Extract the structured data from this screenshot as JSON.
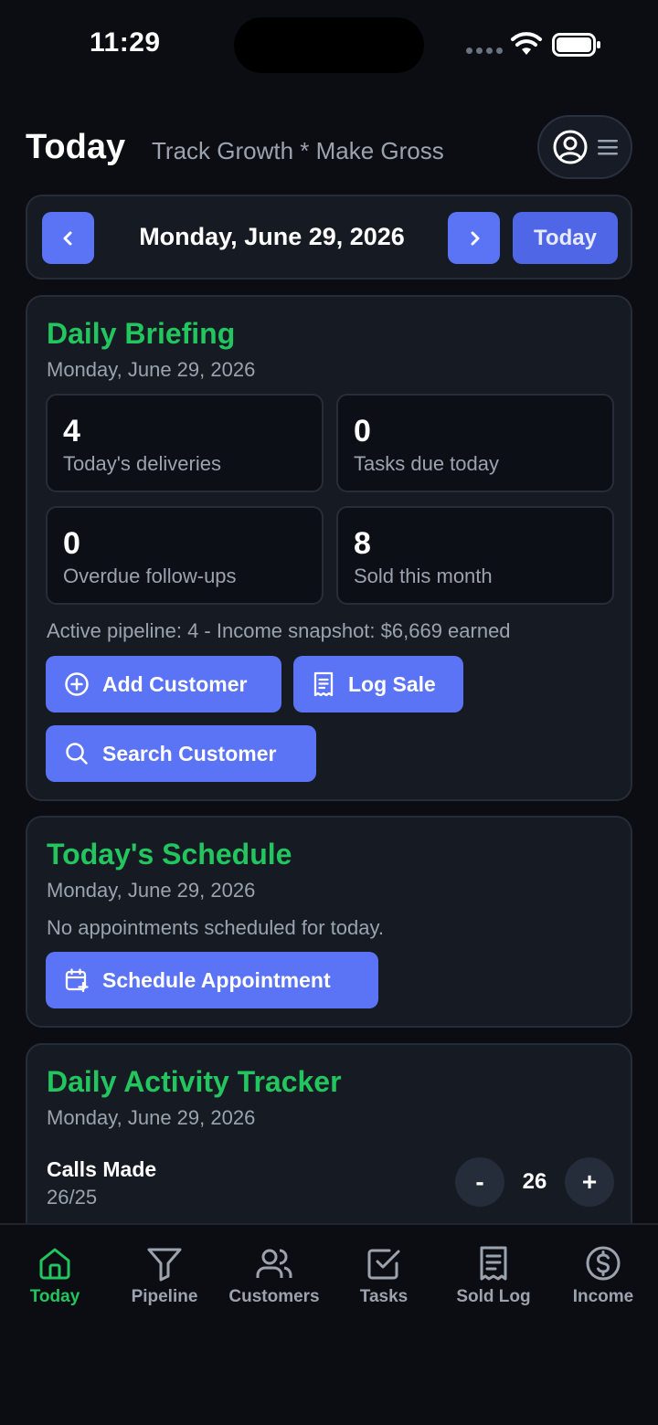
{
  "status_bar": {
    "time": "11:29"
  },
  "header": {
    "title": "Today",
    "subtitle": "Track Growth * Make Gross"
  },
  "date_nav": {
    "date": "Monday, June 29, 2026",
    "today_label": "Today"
  },
  "briefing": {
    "title": "Daily Briefing",
    "date": "Monday, June 29, 2026",
    "stats": [
      {
        "value": "4",
        "label": "Today's deliveries"
      },
      {
        "value": "0",
        "label": "Tasks due today"
      },
      {
        "value": "0",
        "label": "Overdue follow-ups"
      },
      {
        "value": "8",
        "label": "Sold this month"
      }
    ],
    "pipeline_text": "Active pipeline: 4 - Income snapshot: $6,669 earned",
    "buttons": {
      "add_customer": "Add Customer",
      "log_sale": "Log Sale",
      "search_customer": "Search Customer"
    }
  },
  "schedule": {
    "title": "Today's Schedule",
    "date": "Monday, June 29, 2026",
    "empty_text": "No appointments scheduled for today.",
    "button": "Schedule Appointment"
  },
  "tracker": {
    "title": "Daily Activity Tracker",
    "date": "Monday, June 29, 2026",
    "items": [
      {
        "label": "Calls Made",
        "progress": "26/25",
        "value": "26",
        "minus": "-",
        "plus": "+"
      }
    ]
  },
  "tabs": [
    {
      "label": "Today",
      "icon": "home-icon",
      "active": true
    },
    {
      "label": "Pipeline",
      "icon": "filter-icon",
      "active": false
    },
    {
      "label": "Customers",
      "icon": "users-icon",
      "active": false
    },
    {
      "label": "Tasks",
      "icon": "check-square-icon",
      "active": false
    },
    {
      "label": "Sold Log",
      "icon": "receipt-icon",
      "active": false
    },
    {
      "label": "Income",
      "icon": "dollar-circle-icon",
      "active": false
    }
  ],
  "colors": {
    "accent_green": "#22c55e",
    "button_blue": "#5b73f5",
    "background": "#0b0d12",
    "card": "#151a23"
  }
}
